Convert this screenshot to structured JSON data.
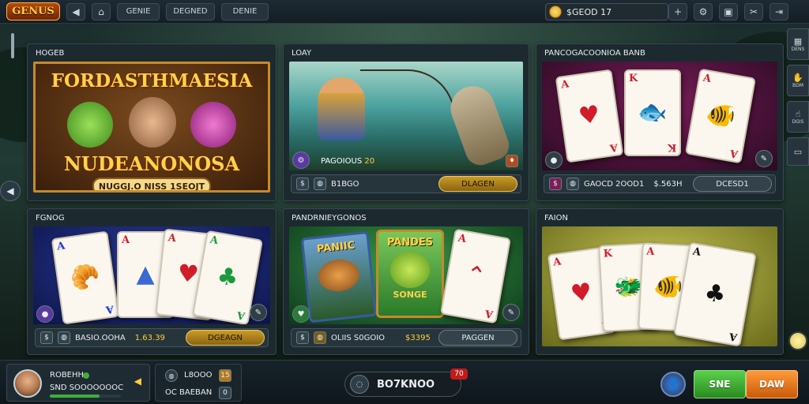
{
  "topbar": {
    "logo": "GENUS",
    "buttons": [
      "GENIE",
      "DEGNED",
      "DENIE"
    ],
    "balance": "$GEOD 17"
  },
  "rightrail": [
    {
      "icon": "grid-icon",
      "glyph": "▦",
      "label": "DENS"
    },
    {
      "icon": "hand-icon",
      "glyph": "✋",
      "label": "BDM"
    },
    {
      "icon": "pointer-icon",
      "glyph": "☝",
      "label": "DGIS"
    },
    {
      "icon": "chat-icon",
      "glyph": "▭",
      "label": ""
    }
  ],
  "panels": [
    {
      "title": "HOGEB",
      "art_title": "FORDASTHMAESIA",
      "art_sub": "NUDEANONOSA",
      "art_banner": "NUGGJ.O NISS 1SEOJT"
    },
    {
      "title": "LOAY",
      "info": "PAGOIOUS",
      "info_val": "20",
      "id": "B1BGO",
      "button": "DLAGEN"
    },
    {
      "title": "PANCOGACOONIOA BANB",
      "id": "GAOCD 2OOD1",
      "amount": "$.563H",
      "button": "DCESD1"
    },
    {
      "title": "FGNOG",
      "id": "BASIO.OOHA",
      "amount": "1.63.39",
      "button": "DGEAGN"
    },
    {
      "title": "PANDRNIEYGONOS",
      "art_a": "PANIIC",
      "art_b": "PANDES",
      "art_c": "SONGE",
      "id": "OLIIS S0GOIO",
      "amount": "$3395",
      "button": "PAGGEN"
    },
    {
      "title": "FAION"
    }
  ],
  "bottom": {
    "player_name": "ROBEHH",
    "player_balance": "SND SOOOOOOOC",
    "mini_1": "L8OOO",
    "mini_1_tag": "15",
    "mini_2": "BAEBAN",
    "mini_2_prefix": "OC",
    "mini_2_tag": "0",
    "center_value": "BO7KNOO",
    "center_badge": "70",
    "btn_green": "SNE",
    "btn_orange": "DAW"
  },
  "colors": {
    "green": "#3fae3a",
    "orange": "#f07a18",
    "gold": "#c99a28"
  }
}
